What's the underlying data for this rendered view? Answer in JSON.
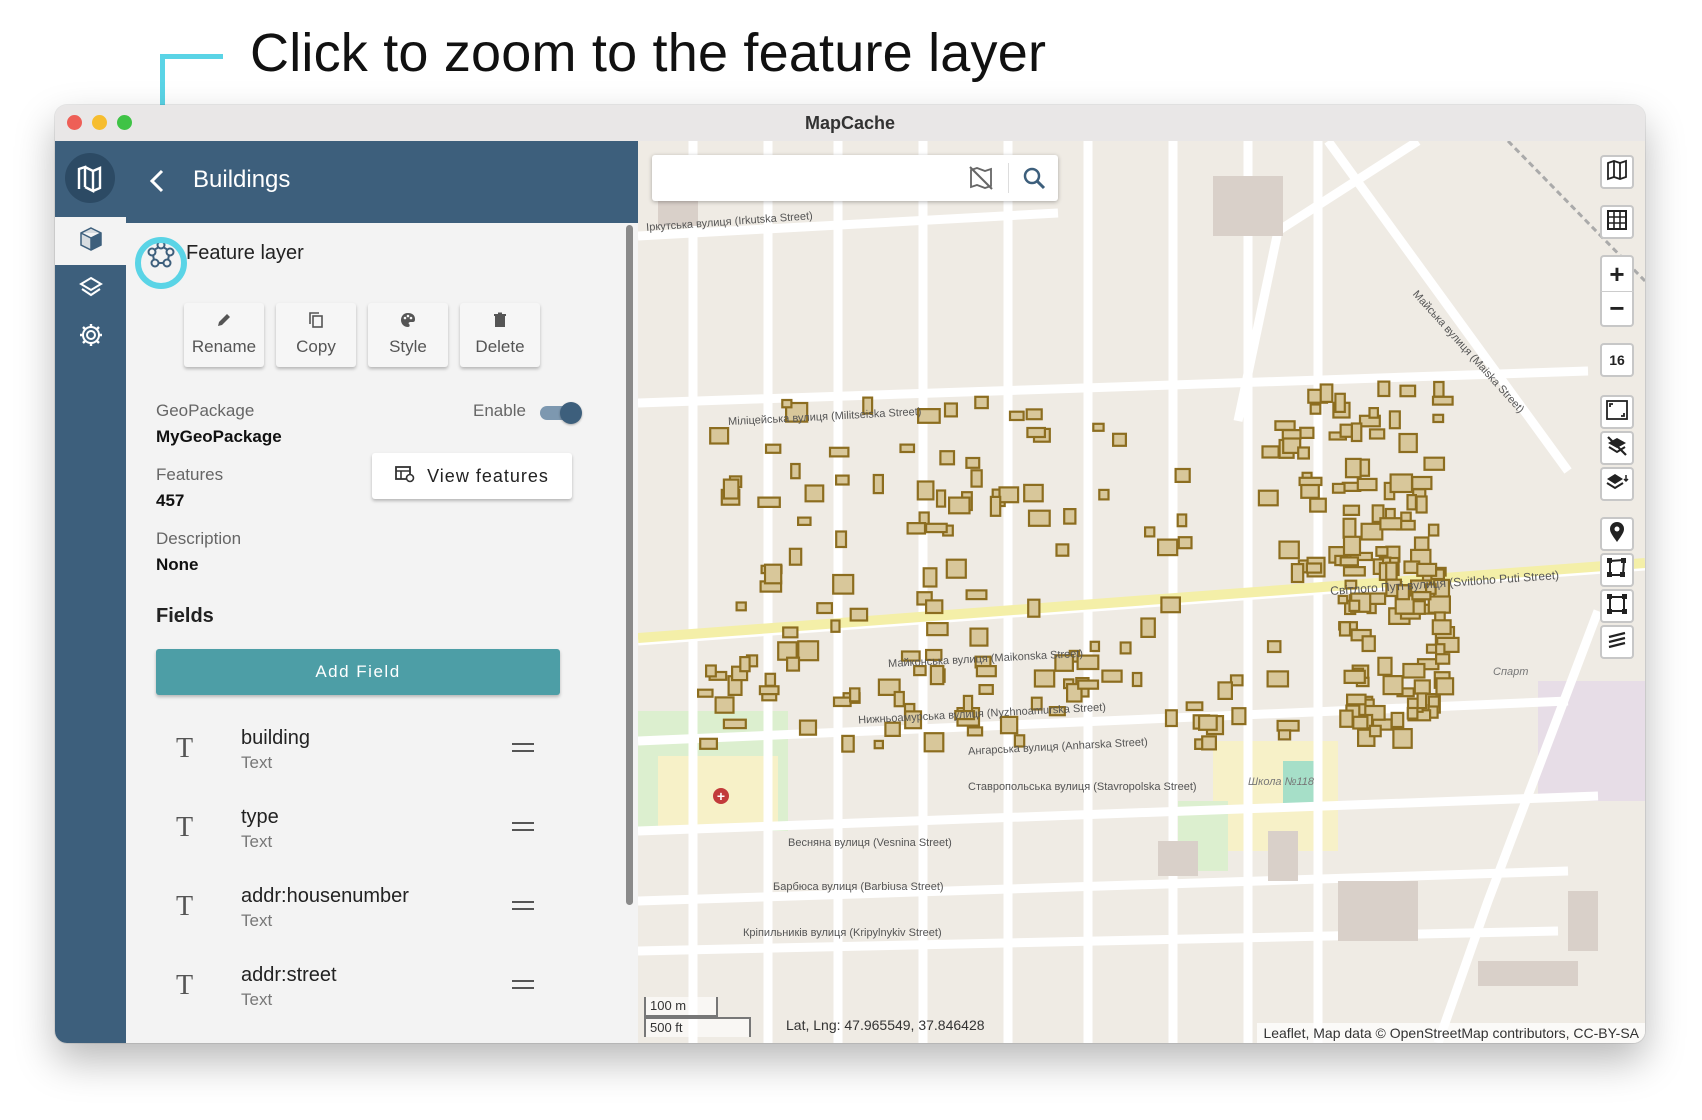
{
  "annotation": {
    "text": "Click to zoom to the feature layer"
  },
  "window": {
    "title": "MapCache"
  },
  "panel": {
    "title": "Buildings",
    "layer_type": "Feature layer",
    "actions": {
      "rename": "Rename",
      "copy": "Copy",
      "style": "Style",
      "delete": "Delete"
    },
    "geopackage_label": "GeoPackage",
    "geopackage_value": "MyGeoPackage",
    "enable_label": "Enable",
    "enabled": true,
    "features_label": "Features",
    "features_value": "457",
    "view_features": "View features",
    "description_label": "Description",
    "description_value": "None",
    "fields_heading": "Fields",
    "add_field": "Add Field",
    "fields": [
      {
        "name": "building",
        "type": "Text"
      },
      {
        "name": "type",
        "type": "Text"
      },
      {
        "name": "addr:housenumber",
        "type": "Text"
      },
      {
        "name": "addr:street",
        "type": "Text"
      }
    ]
  },
  "map": {
    "search_placeholder": "",
    "zoom_level": "16",
    "zoom_in": "+",
    "zoom_out": "−",
    "scale_metric": "100 m",
    "scale_imperial": "500 ft",
    "latlng": "Lat, Lng: 47.965549, 37.846428",
    "attribution": "Leaflet, Map data © OpenStreetMap contributors, CC-BY-SA",
    "streets": [
      "Іркутська вулиця (Irkutska Street)",
      "Міліцейська вулиця (Militseiska Street)",
      "Світлого Путі вулиця (Svitloho Puti Street)",
      "Майконська вулиця (Maikonska Street)",
      "Нижньоамурська вулиця (Nyzhnoamurska Street)",
      "Ангарська вулиця (Anharska Street)",
      "Ставропольська вулиця (Stavropolska Street)",
      "Весняна вулиця (Vesnina Street)",
      "Барбюса вулиця (Barbiusa Street)",
      "Кріпильників вулиця (Kripylnykiv Street)",
      "Майська вулиця (Maiska Street)",
      "Школа №118",
      "Спарт"
    ],
    "building_color": "#8c6d1f",
    "accent_color": "#3d5f7c"
  }
}
